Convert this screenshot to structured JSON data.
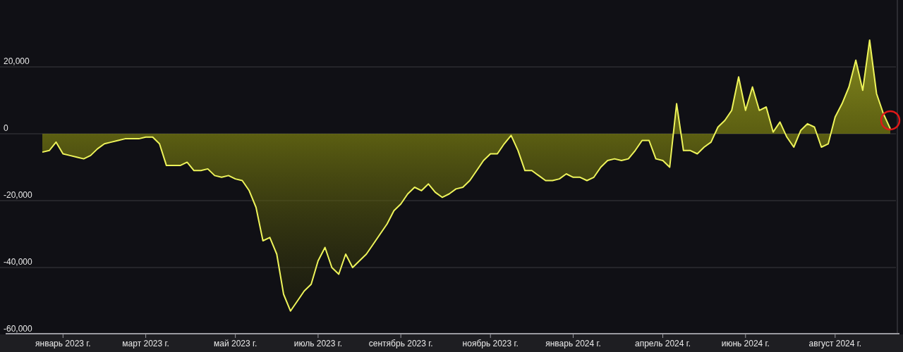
{
  "chart_data": {
    "type": "area",
    "categories": [
      null,
      null,
      null,
      "январь 2023 г.",
      null,
      null,
      null,
      null,
      null,
      null,
      null,
      null,
      null,
      null,
      null,
      "март 2023 г.",
      null,
      null,
      null,
      null,
      null,
      null,
      null,
      null,
      null,
      null,
      null,
      null,
      "май 2023 г.",
      null,
      null,
      null,
      null,
      null,
      null,
      null,
      null,
      null,
      null,
      null,
      "июль 2023 г.",
      null,
      null,
      null,
      null,
      null,
      null,
      null,
      null,
      null,
      null,
      null,
      "сентябрь 2023 г.",
      null,
      null,
      null,
      null,
      null,
      null,
      null,
      null,
      null,
      null,
      null,
      null,
      "ноябрь 2023 г.",
      null,
      null,
      null,
      null,
      null,
      null,
      null,
      null,
      null,
      null,
      null,
      "январь 2024 г.",
      null,
      null,
      null,
      null,
      null,
      null,
      null,
      null,
      null,
      null,
      null,
      null,
      "апрель 2024 г.",
      null,
      null,
      null,
      null,
      null,
      null,
      null,
      null,
      null,
      null,
      null,
      "июнь 2024 г.",
      null,
      null,
      null,
      null,
      null,
      null,
      null,
      null,
      null,
      null,
      null,
      null,
      "август 2024 г.",
      null,
      null,
      null,
      null,
      null,
      null,
      null,
      null
    ],
    "series": [
      {
        "color": "#eef45a",
        "values": [
          -5500,
          -5000,
          -2500,
          -6000,
          -6500,
          -7000,
          -7500,
          -6500,
          -4500,
          -3000,
          -2500,
          -2000,
          -1500,
          -1500,
          -1500,
          -1000,
          -1000,
          -3000,
          -9500,
          -9500,
          -9500,
          -8500,
          -11000,
          -11000,
          -10500,
          -12500,
          -13000,
          -12500,
          -13500,
          -14000,
          -17000,
          -22000,
          -32000,
          -31000,
          -36000,
          -48000,
          -53000,
          -50000,
          -47000,
          -45000,
          -38000,
          -34000,
          -40000,
          -42000,
          -36000,
          -40000,
          -38000,
          -36000,
          -33000,
          -30000,
          -27000,
          -23000,
          -21000,
          -18000,
          -16000,
          -17000,
          -15000,
          -17500,
          -19000,
          -18000,
          -16500,
          -16000,
          -14000,
          -11000,
          -8000,
          -6000,
          -6000,
          -3000,
          -500,
          -5000,
          -11000,
          -11000,
          -12500,
          -14000,
          -14000,
          -13500,
          -12000,
          -13000,
          -13000,
          -14000,
          -13000,
          -10000,
          -8000,
          -7500,
          -8000,
          -7500,
          -5000,
          -2000,
          -2000,
          -7500,
          -8000,
          -10000,
          9000,
          -5000,
          -5000,
          -6000,
          -4000,
          -2500,
          2000,
          4000,
          7000,
          17000,
          7000,
          14000,
          7000,
          8000,
          500,
          3500,
          -1000,
          -4000,
          1000,
          3000,
          2000,
          -4000,
          -3000,
          5000,
          9000,
          14000,
          22000,
          13000,
          28000,
          12000,
          6000,
          1500
        ]
      }
    ],
    "grid": true,
    "ylim": [
      -60000,
      40000
    ],
    "yticks": [
      {
        "value": 20000,
        "label": "20,000"
      },
      {
        "value": 0,
        "label": "0"
      },
      {
        "value": -20000,
        "label": "-20,000"
      },
      {
        "value": -40000,
        "label": "-40,000"
      },
      {
        "value": -60000,
        "label": "-60,000"
      }
    ]
  }
}
